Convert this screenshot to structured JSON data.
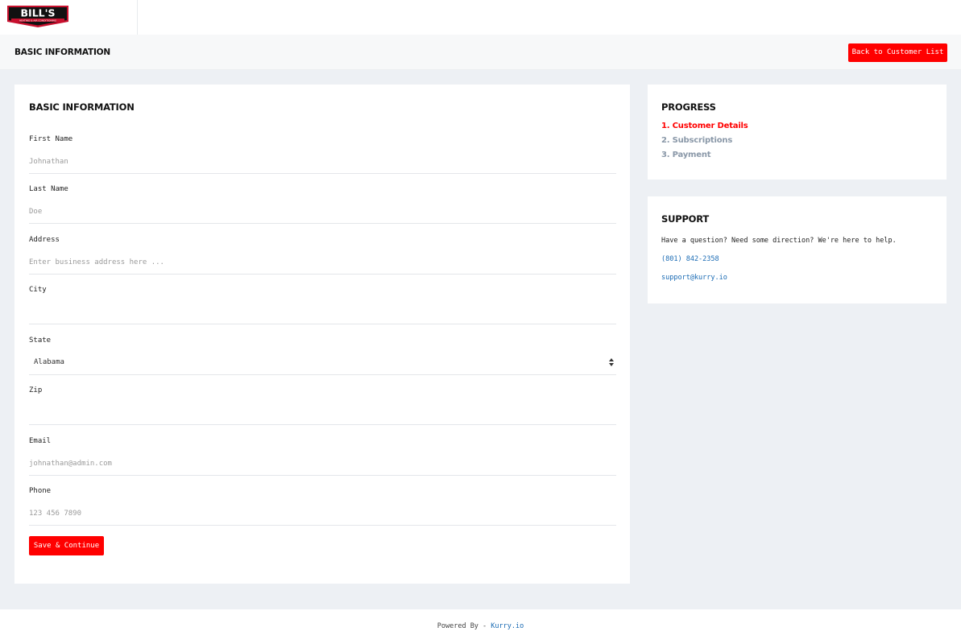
{
  "logo": {
    "title": "BILL'S",
    "subtitle": "HEATING & AIR CONDITIONING"
  },
  "header": {
    "title": "BASIC INFORMATION",
    "back_button": "Back to Customer List"
  },
  "form": {
    "title": "BASIC INFORMATION",
    "fields": {
      "first_name": {
        "label": "First Name",
        "placeholder": "Johnathan"
      },
      "last_name": {
        "label": "Last Name",
        "placeholder": "Doe"
      },
      "address": {
        "label": "Address",
        "placeholder": "Enter business address here ..."
      },
      "city": {
        "label": "City",
        "placeholder": ""
      },
      "state": {
        "label": "State",
        "value": "Alabama"
      },
      "zip": {
        "label": "Zip",
        "placeholder": ""
      },
      "email": {
        "label": "Email",
        "placeholder": "johnathan@admin.com"
      },
      "phone": {
        "label": "Phone",
        "placeholder": "123 456 7890"
      }
    },
    "save_button": "Save & Continue"
  },
  "progress": {
    "title": "PROGRESS",
    "steps": [
      {
        "label": "1. Customer Details",
        "active": true
      },
      {
        "label": "2. Subscriptions",
        "active": false
      },
      {
        "label": "3. Payment",
        "active": false
      }
    ]
  },
  "support": {
    "title": "SUPPORT",
    "text": "Have a question? Need some direction? We're here to help.",
    "phone": "(801) 842-2358",
    "email": "support@kurry.io"
  },
  "footer": {
    "prefix": "Powered By - ",
    "link": "Kurry.io"
  },
  "colors": {
    "accent": "#ff0000",
    "link": "#1a6bb4",
    "inactive_step": "#8a98a8",
    "page_background": "#edf0f4"
  }
}
